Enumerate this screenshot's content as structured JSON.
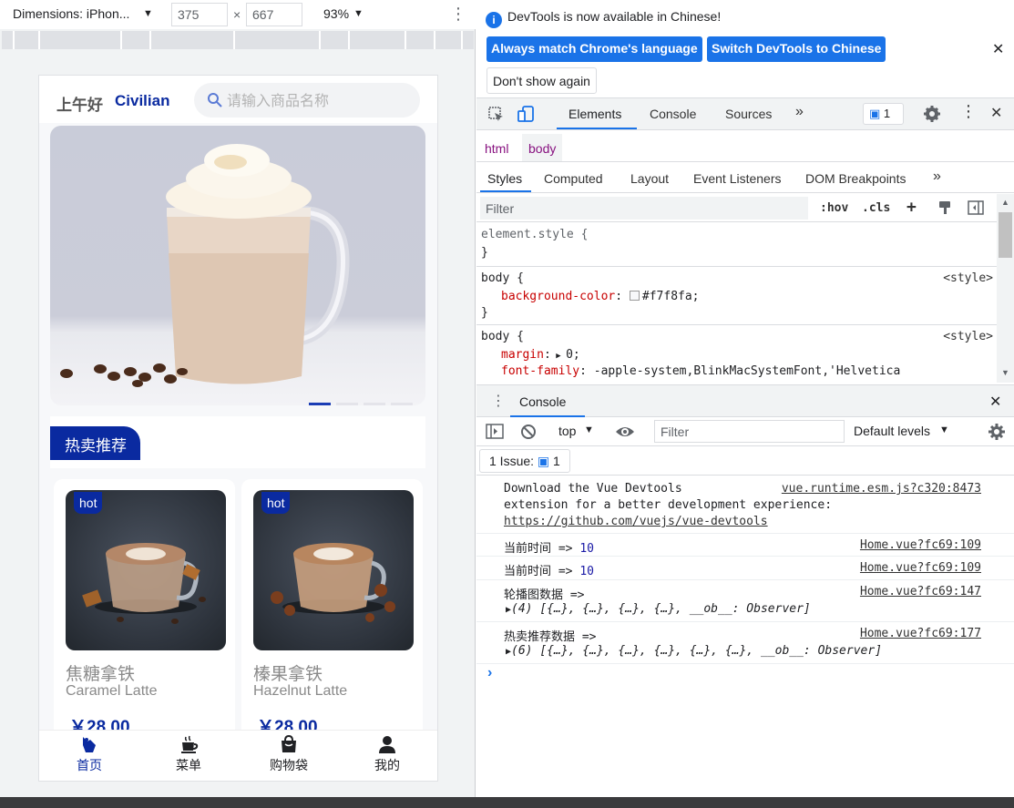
{
  "device_toolbar": {
    "dimensions_label": "Dimensions: iPhon...",
    "width": "375",
    "height": "667",
    "times": "×",
    "zoom": "93%"
  },
  "app": {
    "greeting": "上午好",
    "username": "Civilian",
    "search_placeholder": "请输入商品名称",
    "section_title": "热卖推荐",
    "products": [
      {
        "badge": "hot",
        "name_cn": "焦糖拿铁",
        "name_en": "Caramel Latte",
        "price": "￥28.00"
      },
      {
        "badge": "hot",
        "name_cn": "榛果拿铁",
        "name_en": "Hazelnut Latte",
        "price": "￥28.00"
      }
    ],
    "tabbar": [
      {
        "label": "首页",
        "icon": "home-icon"
      },
      {
        "label": "菜单",
        "icon": "coffee-cup-icon"
      },
      {
        "label": "购物袋",
        "icon": "shopping-bag-icon"
      },
      {
        "label": "我的",
        "icon": "user-icon"
      }
    ],
    "colors": {
      "brand": "#0a2aa0",
      "page_bg": "#f7f8fa"
    }
  },
  "devtools": {
    "notice": "DevTools is now available in Chinese!",
    "btn_always_match": "Always match Chrome's language",
    "btn_switch": "Switch DevTools to Chinese",
    "btn_dont_show": "Don't show again",
    "tabs": [
      "Elements",
      "Console",
      "Sources"
    ],
    "issue_count": "1",
    "breadcrumbs": [
      "html",
      "body"
    ],
    "style_tabs": [
      "Styles",
      "Computed",
      "Layout",
      "Event Listeners",
      "DOM Breakpoints"
    ],
    "filter_placeholder": "Filter",
    "hov": ":hov",
    "cls": ".cls",
    "rules": {
      "element_style": "element.style {",
      "close": "}",
      "body_selector": "body {",
      "source": "<style>",
      "bg_prop": "background-color",
      "bg_val": "#f7f8fa;",
      "margin_prop": "margin",
      "margin_val": "0;",
      "font_prop": "font-family",
      "font_val": "-apple-system,BlinkMacSystemFont,'Helvetica"
    },
    "console": {
      "title": "Console",
      "context": "top",
      "filter_placeholder": "Filter",
      "levels": "Default levels",
      "issues_label": "1 Issue:",
      "issues_count": "1",
      "logs": [
        {
          "line1": "Download the Vue Devtools",
          "line2": "extension for a better development experience:",
          "line3": "https://github.com/vuejs/vue-devtools",
          "source": "vue.runtime.esm.js?c320:8473"
        },
        {
          "text": "当前时间 => ",
          "value": "10",
          "source": "Home.vue?fc69:109"
        },
        {
          "text": "当前时间 => ",
          "value": "10",
          "source": "Home.vue?fc69:109"
        },
        {
          "text": "轮播图数据 =>",
          "object": "(4) [{…}, {…}, {…}, {…}, __ob__: Observer]",
          "source": "Home.vue?fc69:147"
        },
        {
          "text": "热卖推荐数据 =>",
          "object": "(6) [{…}, {…}, {…}, {…}, {…}, {…}, __ob__: Observer]",
          "source": "Home.vue?fc69:177"
        }
      ]
    }
  }
}
